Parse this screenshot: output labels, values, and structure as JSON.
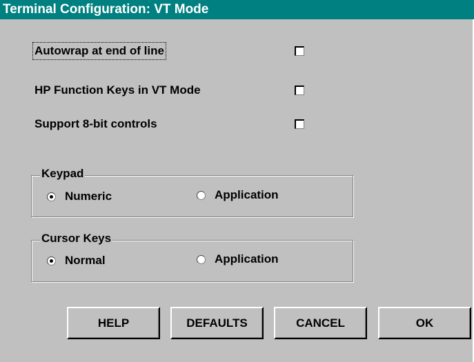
{
  "window": {
    "title": "Terminal Configuration: VT Mode"
  },
  "options": [
    {
      "label": "Autowrap at end of line",
      "checked": false
    },
    {
      "label": "HP Function Keys in VT Mode",
      "checked": false
    },
    {
      "label": "Support 8-bit controls",
      "checked": false
    }
  ],
  "keypad": {
    "legend": "Keypad",
    "numeric_label": "Numeric",
    "application_label": "Application",
    "selected": "Numeric"
  },
  "cursor_keys": {
    "legend": "Cursor Keys",
    "normal_label": "Normal",
    "application_label": "Application",
    "selected": "Normal"
  },
  "buttons": {
    "help": "HELP",
    "defaults": "DEFAULTS",
    "cancel": "CANCEL",
    "ok": "OK"
  },
  "colors": {
    "titlebar": "#008080",
    "face": "#c0c0c0"
  }
}
